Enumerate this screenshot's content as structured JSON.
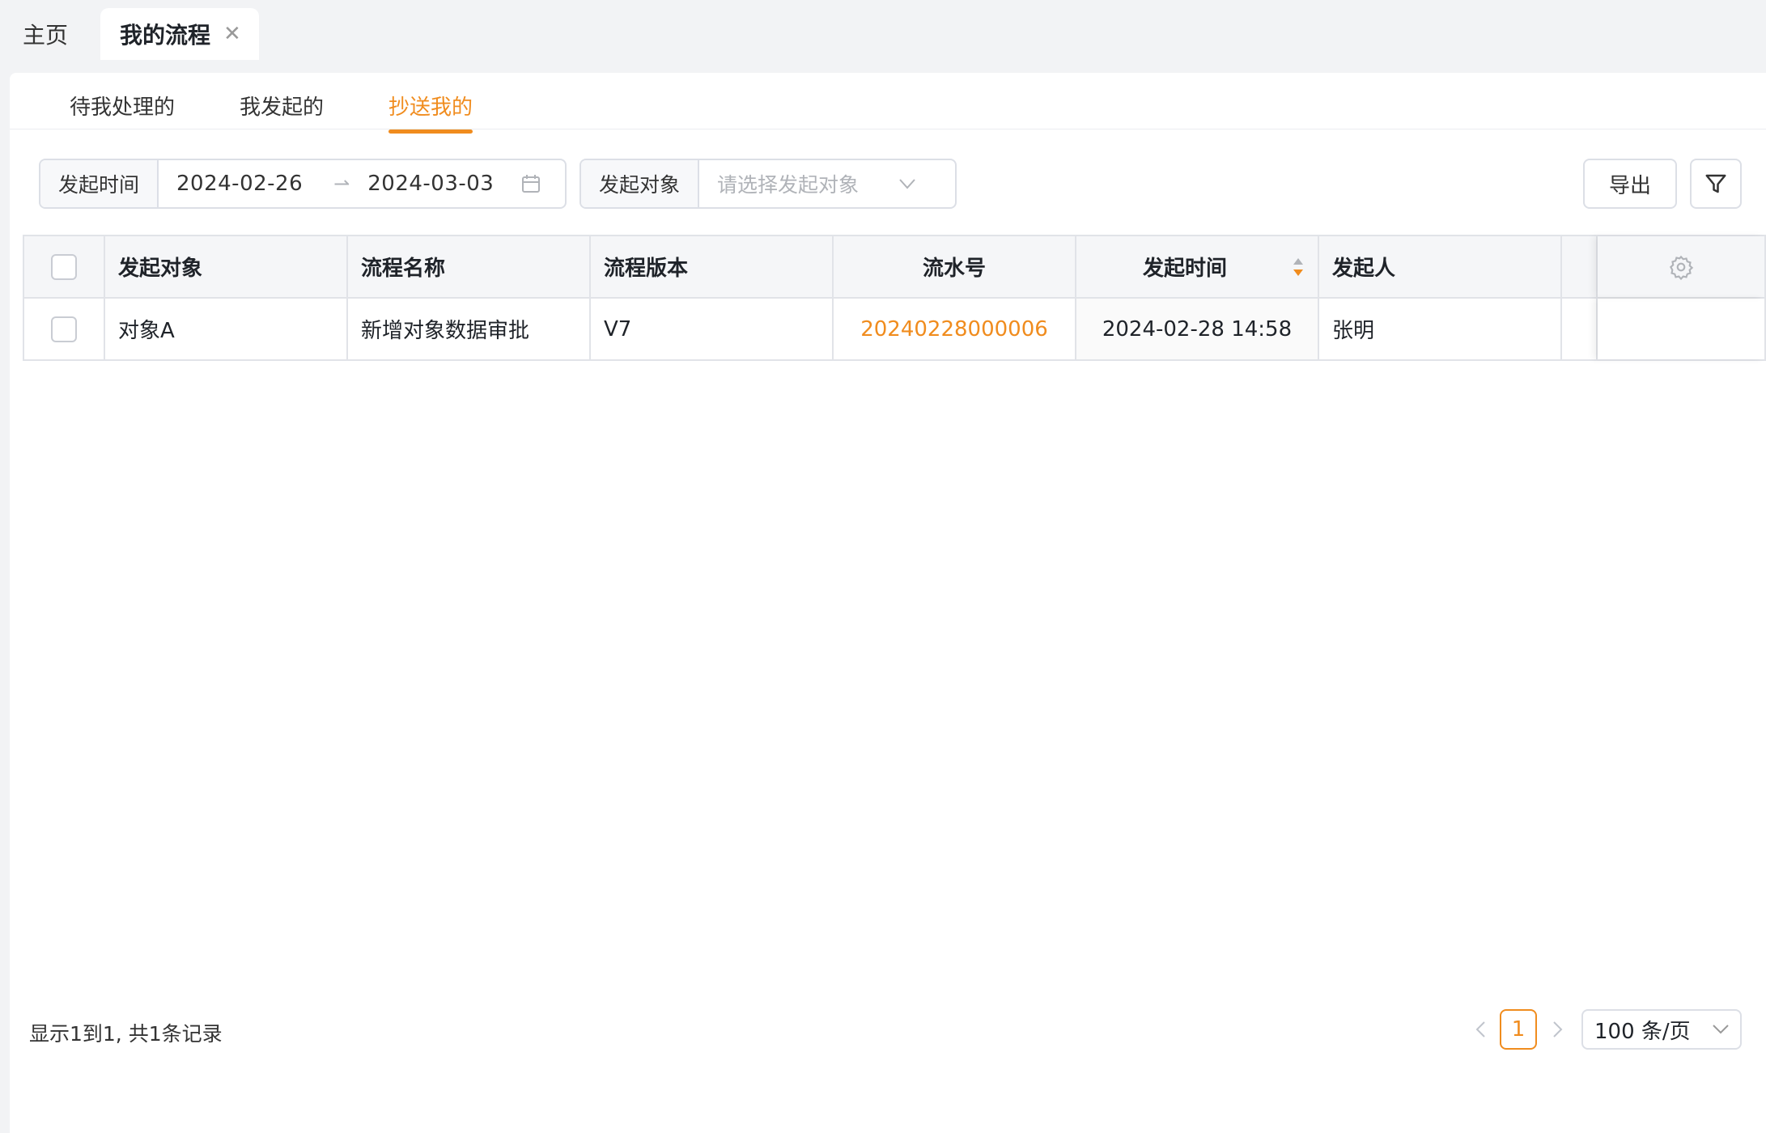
{
  "page_tabs": {
    "home": "主页",
    "active": "我的流程",
    "close_icon": "close-icon"
  },
  "sub_tabs": [
    {
      "label": "待我处理的",
      "active": false
    },
    {
      "label": "我发起的",
      "active": false
    },
    {
      "label": "抄送我的",
      "active": true
    }
  ],
  "filters": {
    "date_label": "发起时间",
    "date_start": "2024-02-26",
    "date_sep": "→",
    "date_end": "2024-03-03",
    "target_label": "发起对象",
    "target_placeholder": "请选择发起对象"
  },
  "toolbar": {
    "export_label": "导出"
  },
  "table": {
    "columns": [
      "发起对象",
      "流程名称",
      "流程版本",
      "流水号",
      "发起时间",
      "发起人"
    ],
    "rows": [
      {
        "target": "对象A",
        "process_name": "新增对象数据审批",
        "version": "V7",
        "serial_no": "20240228000006",
        "start_time": "2024-02-28 14:58",
        "initiator": "张明"
      }
    ]
  },
  "footer": {
    "summary": "显示1到1, 共1条记录",
    "current_page": "1",
    "page_size": "100 条/页"
  },
  "colors": {
    "accent": "#f08c1e",
    "border": "#dcdfe6"
  }
}
